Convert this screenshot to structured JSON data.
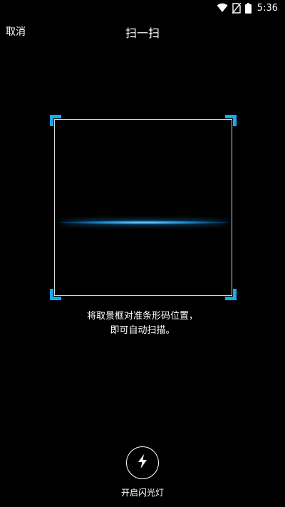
{
  "status_bar": {
    "time": "5:36",
    "icons": [
      "wifi-icon",
      "no-sim-icon",
      "battery-icon"
    ]
  },
  "header": {
    "cancel_label": "取消",
    "title": "扫一扫"
  },
  "scanner": {
    "hint_line1": "将取景框对准条形码位置，",
    "hint_line2": "即可自动扫描。",
    "accent_color": "#1aa8f0"
  },
  "flashlight": {
    "label": "开启闪光灯",
    "icon": "flash-icon"
  }
}
